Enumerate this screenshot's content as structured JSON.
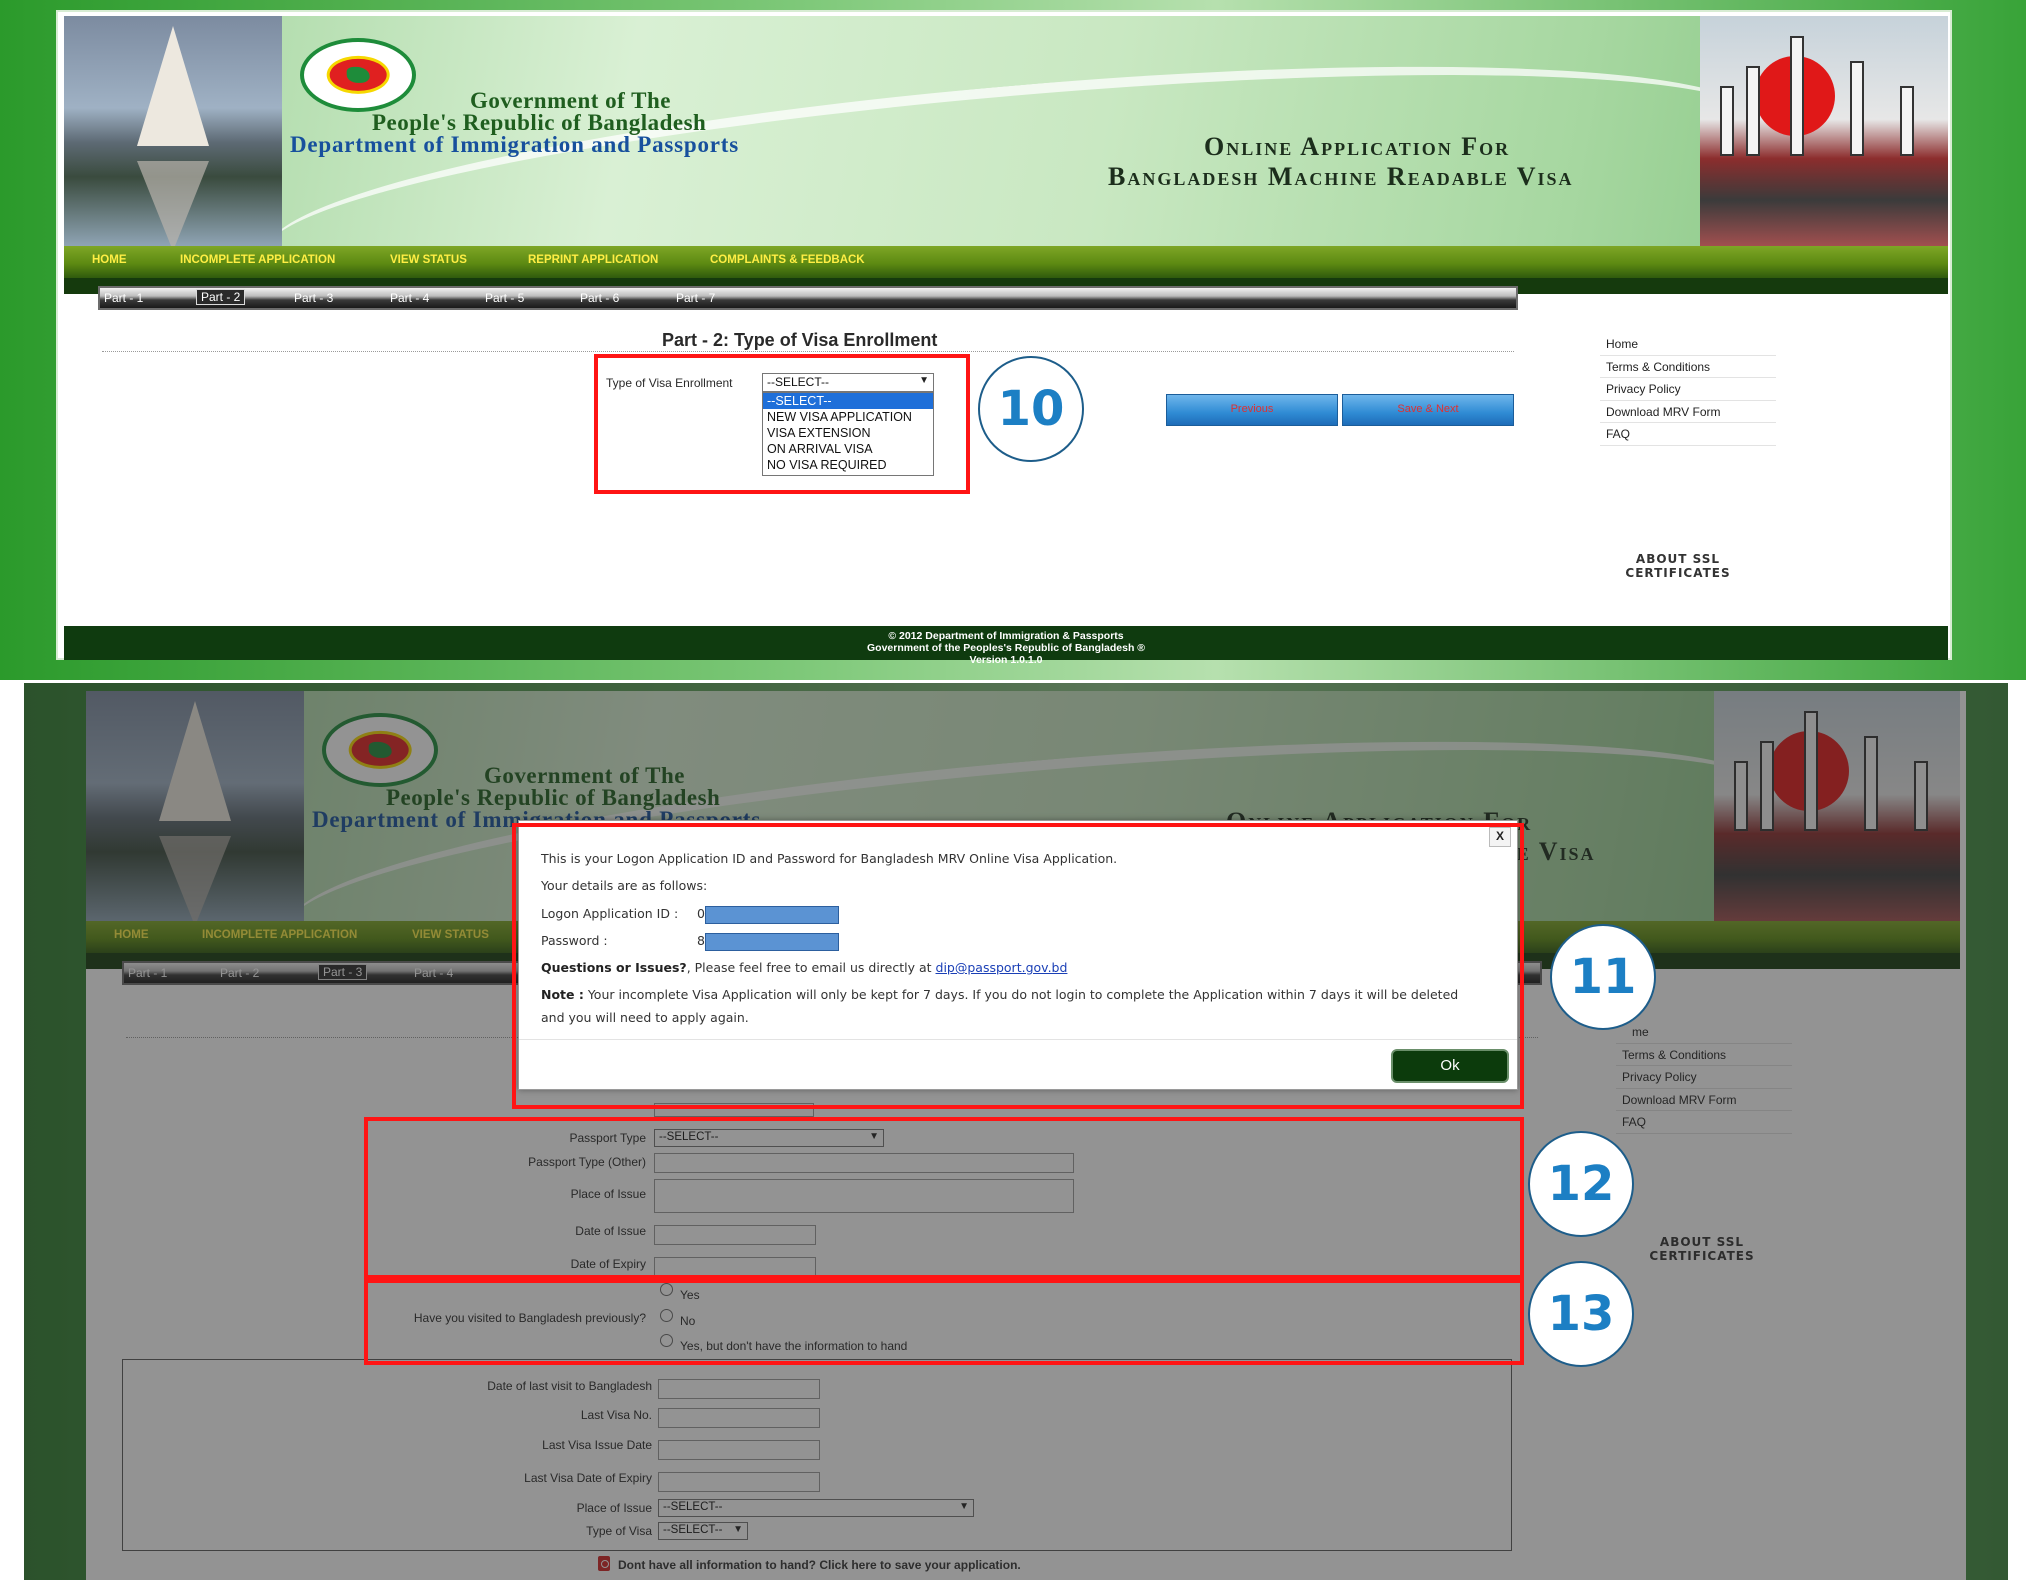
{
  "header": {
    "gov_line1": "Government of The",
    "gov_line2": "People's Republic of Bangladesh",
    "gov_line3": "Department of Immigration and Passports",
    "online_line1": "Online Application For",
    "online_line2": "Bangladesh Machine Readable Visa"
  },
  "nav": {
    "items": [
      "HOME",
      "INCOMPLETE APPLICATION",
      "VIEW STATUS",
      "REPRINT APPLICATION",
      "COMPLAINTS & FEEDBACK"
    ]
  },
  "parts": [
    "Part - 1",
    "Part - 2",
    "Part - 3",
    "Part - 4",
    "Part - 5",
    "Part - 6",
    "Part - 7"
  ],
  "step1": {
    "page_title": "Part - 2: Type of Visa Enrollment",
    "field_label": "Type of Visa Enrollment",
    "select_value": "--SELECT--",
    "options": [
      "--SELECT--",
      "NEW VISA APPLICATION",
      "VISA EXTENSION",
      "ON ARRIVAL VISA",
      "NO VISA REQUIRED"
    ],
    "previous_button": "Previous",
    "next_button": "Save & Next",
    "step_number": "10"
  },
  "sidebar": {
    "links": [
      "Home",
      "Terms & Conditions",
      "Privacy Policy",
      "Download MRV Form",
      "FAQ"
    ],
    "ssl_line1": "ABOUT SSL",
    "ssl_line2": "CERTIFICATES"
  },
  "footer": {
    "line1": "© 2012 Department of Immigration & Passports",
    "line2": "Government of the Peoples's Republic of Bangladesh ®",
    "line3": "Version 1.0.1.0"
  },
  "screen2": {
    "bg_nav": [
      "HOME",
      "INCOMPLETE APPLICATION",
      "VIEW STATUS"
    ],
    "bg_parts": [
      "Part - 1",
      "Part - 2",
      "Part - 3",
      "Part - 4"
    ],
    "bg_sidebar": [
      "me",
      "Terms & Conditions",
      "Privacy Policy",
      "Download MRV Form",
      "FAQ"
    ],
    "modal": {
      "close_label": "X",
      "line1": "This is your Logon Application ID and Password for Bangladesh MRV Online Visa Application.",
      "line2": "Your details are as follows:",
      "id_label": "Logon Application ID :",
      "id_prefix": "0",
      "password_label": "Password :",
      "password_prefix": "8",
      "questions_bold": "Questions or Issues?",
      "questions_text": ", Please feel free to email us directly at ",
      "email": "dip@passport.gov.bd",
      "note_bold": "Note :",
      "note_text": " Your incomplete Visa Application will only be kept for 7 days. If you do not login to complete the Application within 7 days it will be deleted",
      "note_text2": "and you will need to apply again.",
      "ok_button": "Ok"
    },
    "form": {
      "passport_type_label": "Passport Type",
      "passport_type_value": "--SELECT--",
      "passport_other_label": "Passport Type (Other)",
      "place_issue_label": "Place of Issue",
      "date_issue_label": "Date of Issue",
      "date_expiry_label": "Date of Expiry",
      "visited_question": "Have you visited to Bangladesh previously?",
      "visited_options": [
        "Yes",
        "No",
        "Yes, but don't have the information to hand"
      ],
      "last_visit_label": "Date of last visit to Bangladesh",
      "last_visa_no_label": "Last Visa No.",
      "last_visa_issue_label": "Last Visa Issue Date",
      "last_visa_expiry_label": "Last Visa Date of Expiry",
      "place_issue2_label": "Place of Issue",
      "place_issue2_value": "--SELECT--",
      "type_visa_label": "Type of Visa",
      "type_visa_value": "--SELECT--",
      "save_hint": "Dont have all information to hand? Click here to save your application."
    },
    "step_numbers": [
      "11",
      "12",
      "13"
    ]
  }
}
